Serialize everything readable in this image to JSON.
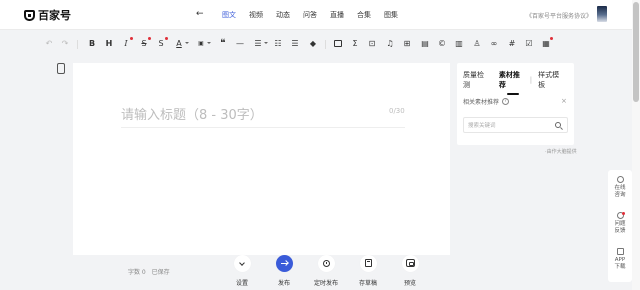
{
  "header": {
    "logo_text": "百家号",
    "back_icon": "arrow-left-icon",
    "tabs": [
      {
        "label": "图文",
        "active": true
      },
      {
        "label": "视频",
        "active": false
      },
      {
        "label": "动态",
        "active": false
      },
      {
        "label": "问答",
        "active": false
      },
      {
        "label": "直播",
        "active": false
      },
      {
        "label": "合集",
        "active": false
      },
      {
        "label": "图集",
        "active": false
      }
    ],
    "agreement": "《百家号平台服务协议》"
  },
  "toolbar": {
    "icons": [
      "undo-icon",
      "redo-icon",
      "bold-icon",
      "heading-icon",
      "italic-icon",
      "strikethrough-icon",
      "subscript-icon",
      "font-color-icon",
      "font-size-icon",
      "quote-icon",
      "horizontal-rule-icon",
      "align-icon",
      "ordered-list-icon",
      "unordered-list-icon",
      "clear-format-icon",
      "image-icon",
      "formula-icon",
      "video-icon",
      "music-icon",
      "table-icon",
      "file-icon",
      "copyright-icon",
      "store-icon",
      "person-icon",
      "link-icon",
      "topic-icon",
      "template-icon",
      "schedule-icon"
    ],
    "glyphs": {
      "bold": "B",
      "heading": "H",
      "italic": "I",
      "strike": "S",
      "font_color": "A",
      "quote": "❝",
      "hr": "—",
      "formula": "Σ",
      "music": "♫",
      "copyright": "©",
      "topic": "#"
    },
    "accent_dot": "#e0303a"
  },
  "editor": {
    "title_placeholder": "请输入标题（8 - 30字）",
    "title_count": "0/30"
  },
  "right_panel": {
    "tabs": [
      {
        "label": "质量检测",
        "active": false
      },
      {
        "label": "素材推荐",
        "active": true
      },
      {
        "label": "样式模板",
        "active": false
      }
    ],
    "section_label": "相关素材推荐",
    "search_placeholder": "搜索关键词",
    "source_note": "·由作大脑提供"
  },
  "float_bar": {
    "items": [
      {
        "label": "在线\n咨询",
        "icon": "chat-icon"
      },
      {
        "label": "问题\n反馈",
        "icon": "feedback-icon"
      },
      {
        "label": "APP\n下载",
        "icon": "phone-icon"
      }
    ]
  },
  "bottom_bar": {
    "word_count": "字数 0",
    "save_status": "已保存",
    "buttons": [
      {
        "label": "设置",
        "icon": "chevron-down-icon"
      },
      {
        "label": "发布",
        "icon": "arrow-right-icon"
      },
      {
        "label": "定时发布",
        "icon": "clock-icon"
      },
      {
        "label": "存草稿",
        "icon": "draft-icon"
      },
      {
        "label": "预览",
        "icon": "preview-icon"
      }
    ]
  },
  "colors": {
    "accent": "#3a5bd9",
    "background": "#f2f3f5",
    "badge": "#e0303a"
  }
}
